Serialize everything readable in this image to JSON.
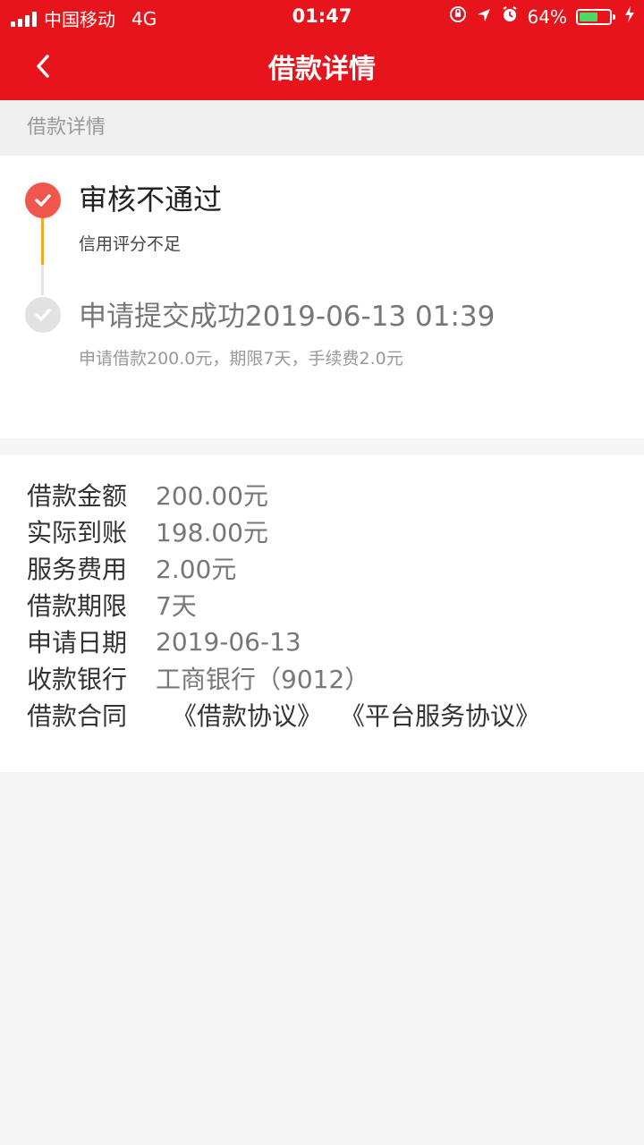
{
  "status_bar": {
    "carrier": "中国移动",
    "network": "4G",
    "time": "01:47",
    "battery_percent": "64%",
    "battery_level": 0.64,
    "battery_color": "#4cd964"
  },
  "header": {
    "title": "借款详情",
    "back_icon": "chevron-left-icon",
    "background": "#e8141b"
  },
  "section": {
    "title": "借款详情"
  },
  "timeline": {
    "steps": [
      {
        "title": "审核不通过",
        "subtitle": "信用评分不足",
        "state": "active",
        "icon": "check-icon",
        "color": "#f0564b"
      },
      {
        "title": "申请提交成功2019-06-13 01:39",
        "subtitle": "申请借款200.0元，期限7天，手续费2.0元",
        "state": "inactive",
        "icon": "check-icon",
        "color": "#e2e2e2"
      }
    ],
    "connector_colors": [
      "#f5a623",
      "#e3e3e3"
    ]
  },
  "details": {
    "rows": [
      {
        "label": "借款金额",
        "value": "200.00元"
      },
      {
        "label": "实际到账",
        "value": "198.00元"
      },
      {
        "label": "服务费用",
        "value": "2.00元"
      },
      {
        "label": "借款期限",
        "value": "7天"
      },
      {
        "label": "申请日期",
        "value": "2019-06-13"
      },
      {
        "label": "收款银行",
        "value": "工商银行（9012）"
      }
    ],
    "contract": {
      "label": "借款合同",
      "links": [
        "《借款协议》",
        "《平台服务协议》"
      ]
    }
  }
}
